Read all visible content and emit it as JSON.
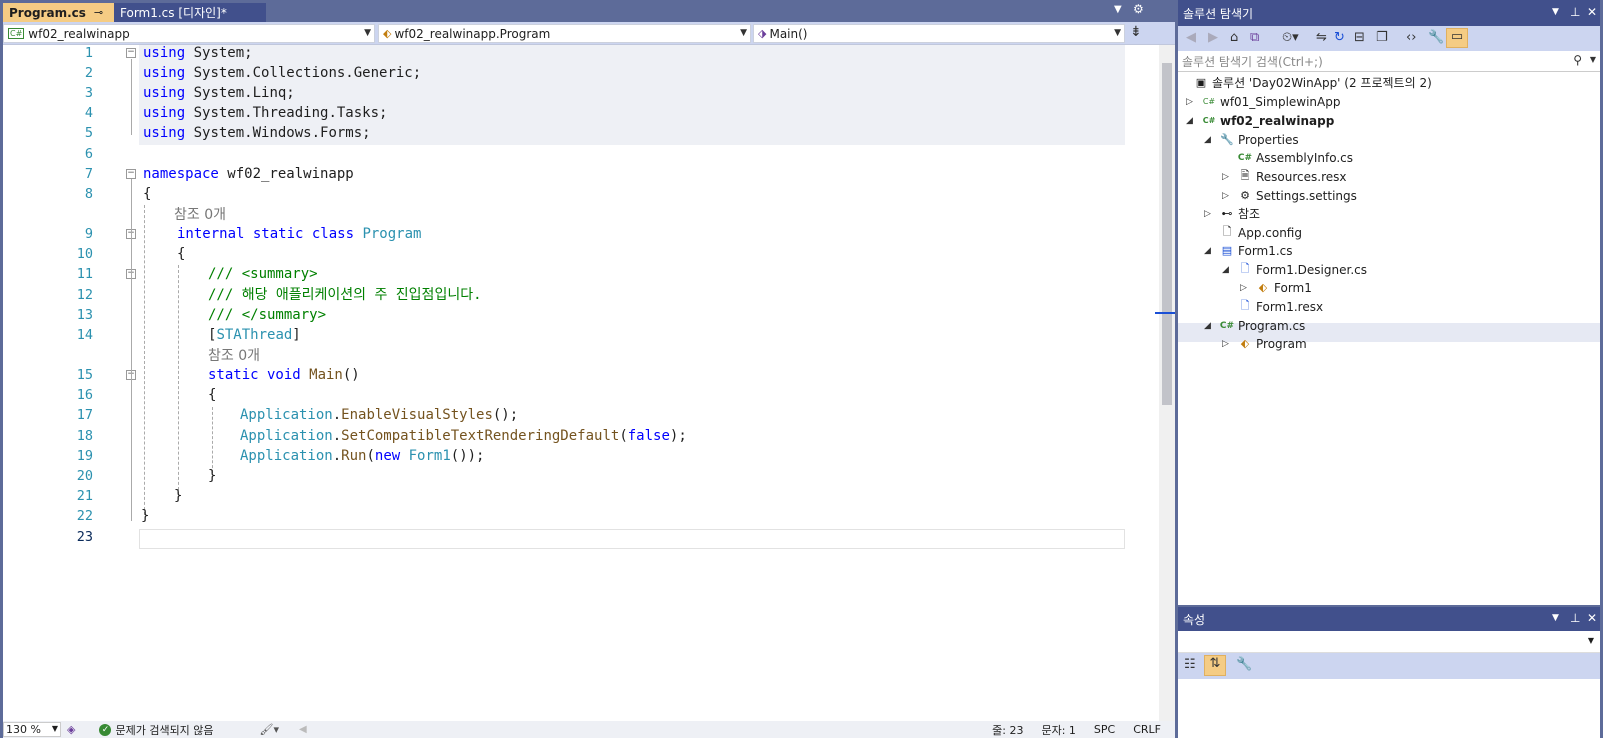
{
  "tabs": {
    "active": {
      "label": "Program.cs",
      "pin": "⊸",
      "close": "✕"
    },
    "inactive": {
      "label": "Form1.cs [디자인]*"
    }
  },
  "navbar": {
    "project": "wf02_realwinapp",
    "class": "wf02_realwinapp.Program",
    "member": "Main()"
  },
  "code": {
    "line_numbers": [
      "1",
      "2",
      "3",
      "4",
      "5",
      "6",
      "7",
      "8",
      "9",
      "10",
      "11",
      "12",
      "13",
      "14",
      "15",
      "16",
      "17",
      "18",
      "19",
      "20",
      "21",
      "22",
      "23"
    ],
    "references_label": "참조 0개",
    "lines": {
      "l1_kw": "using",
      "l1_ns": " System;",
      "l2_kw": "using",
      "l2_ns": " System.Collections.Generic;",
      "l3_kw": "using",
      "l3_ns": " System.Linq;",
      "l4_kw": "using",
      "l4_ns": " System.Threading.Tasks;",
      "l5_kw": "using",
      "l5_ns": " System.Windows.Forms;",
      "l7_kw": "namespace",
      "l7_ns": " wf02_realwinapp",
      "l8": "{",
      "l9_kw": "internal static class",
      "l9_ty": " Program",
      "l10": "{",
      "l11": "/// <summary>",
      "l12": "/// 해당 애플리케이션의 주 진입점입니다.",
      "l13": "/// </summary>",
      "l14_a": "[",
      "l14_ty": "STAThread",
      "l14_b": "]",
      "l15_kw": "static void",
      "l15_md": " Main",
      "l15_rest": "()",
      "l16": "{",
      "l17_ty": "Application",
      "l17_rest": ".",
      "l17_md": "EnableVisualStyles",
      "l17_end": "();",
      "l18_ty": "Application",
      "l18_rest": ".",
      "l18_md": "SetCompatibleTextRenderingDefault",
      "l18_p": "(",
      "l18_kw": "false",
      "l18_end": ");",
      "l19_ty": "Application",
      "l19_rest": ".",
      "l19_md": "Run",
      "l19_p": "(",
      "l19_kw": "new",
      "l19_ty2": " Form1",
      "l19_end": "());",
      "l20": "}",
      "l21": "}",
      "l22": "}"
    }
  },
  "status": {
    "zoom": "130 %",
    "issues": "문제가 검색되지 않음",
    "line": "줄: 23",
    "col": "문자: 1",
    "spc": "SPC",
    "crlf": "CRLF"
  },
  "solution_explorer": {
    "title": "솔루션 탐색기",
    "search_placeholder": "솔루션 탐색기 검색(Ctrl+;)",
    "solution": "솔루션 'Day02WinApp'  (2 프로젝트의 2)",
    "items": [
      {
        "label": "wf01_SimplewinApp"
      },
      {
        "label": "wf02_realwinapp"
      },
      {
        "label": "Properties"
      },
      {
        "label": "AssemblyInfo.cs"
      },
      {
        "label": "Resources.resx"
      },
      {
        "label": "Settings.settings"
      },
      {
        "label": "참조"
      },
      {
        "label": "App.config"
      },
      {
        "label": "Form1.cs"
      },
      {
        "label": "Form1.Designer.cs"
      },
      {
        "label": "Form1"
      },
      {
        "label": "Form1.resx"
      },
      {
        "label": "Program.cs"
      },
      {
        "label": "Program"
      }
    ]
  },
  "properties": {
    "title": "속성"
  },
  "colors": {
    "accent_tab": "#f5cc84",
    "frame": "#5d6b99",
    "panel_title": "#41508c"
  }
}
